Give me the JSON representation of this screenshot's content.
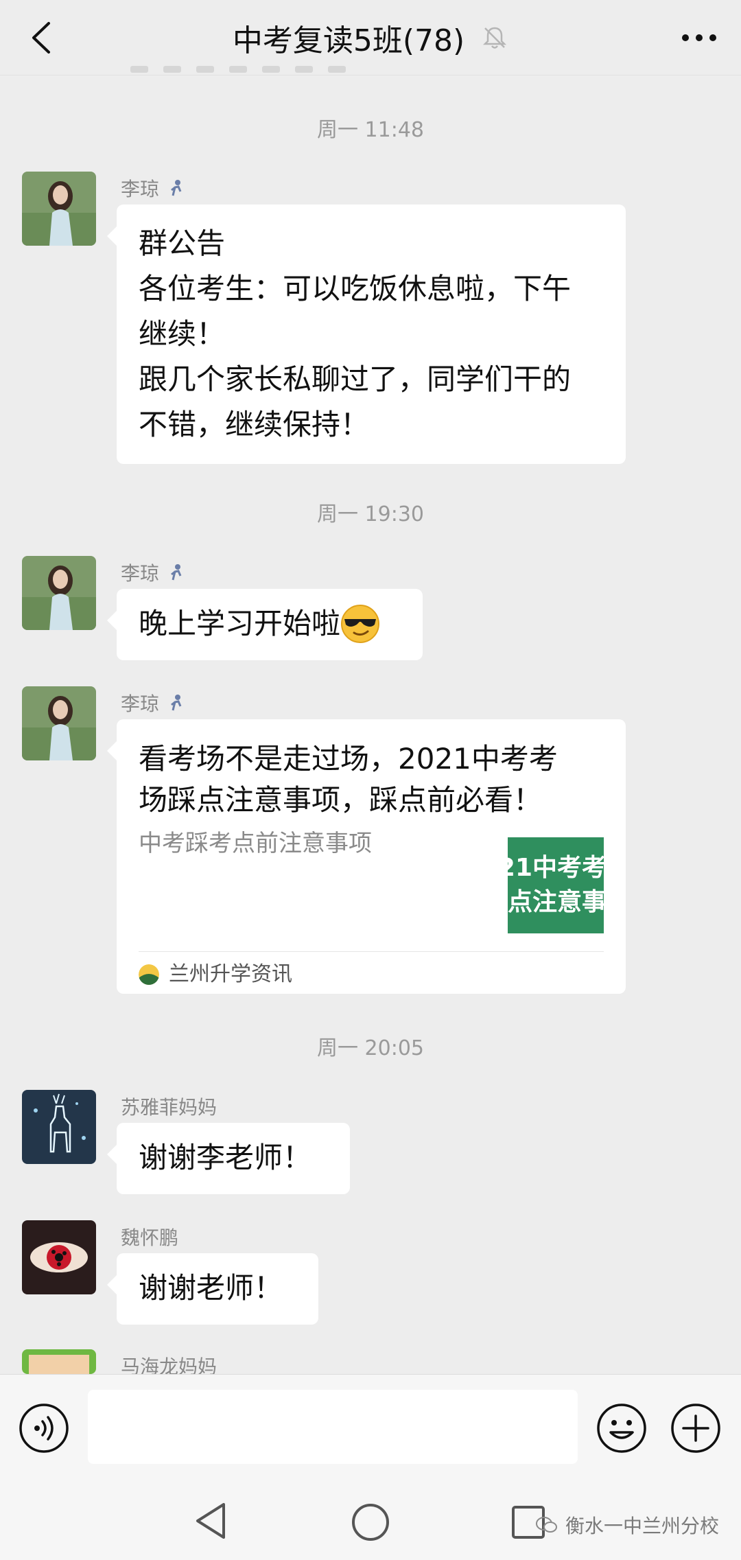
{
  "header": {
    "title": "中考复读5班(78)"
  },
  "messages": [
    {
      "time": "周一 11:48",
      "sender": "李琼",
      "lines": [
        "群公告",
        "各位考生：可以吃饭休息啦，下午",
        "继续！",
        "跟几个家长私聊过了，同学们干的",
        "不错，继续保持！"
      ]
    },
    {
      "time": "周一 19:30",
      "sender": "李琼",
      "lines": [
        "晚上学习开始啦"
      ]
    },
    {
      "sender": "李琼",
      "card": {
        "title_lines": [
          "看考场不是走过场，2021中考考",
          "场踩点注意事项，踩点前必看！"
        ],
        "desc": "中考踩考点前注意事项",
        "thumb_lines": [
          "21中考考",
          "点注意事"
        ],
        "source": "兰州升学资讯"
      }
    },
    {
      "time": "周一 20:05",
      "sender": "苏雅菲妈妈",
      "lines": [
        "谢谢李老师！"
      ]
    },
    {
      "sender": "魏怀鹏",
      "lines": [
        "谢谢老师！"
      ]
    },
    {
      "sender": "马海龙妈妈"
    }
  ],
  "input_bar": {
    "placeholder": ""
  },
  "watermark": "衡水一中兰州分校",
  "colors": {
    "background": "#ededed",
    "bubble": "#ffffff",
    "thumb_green": "#2f8f5e"
  }
}
